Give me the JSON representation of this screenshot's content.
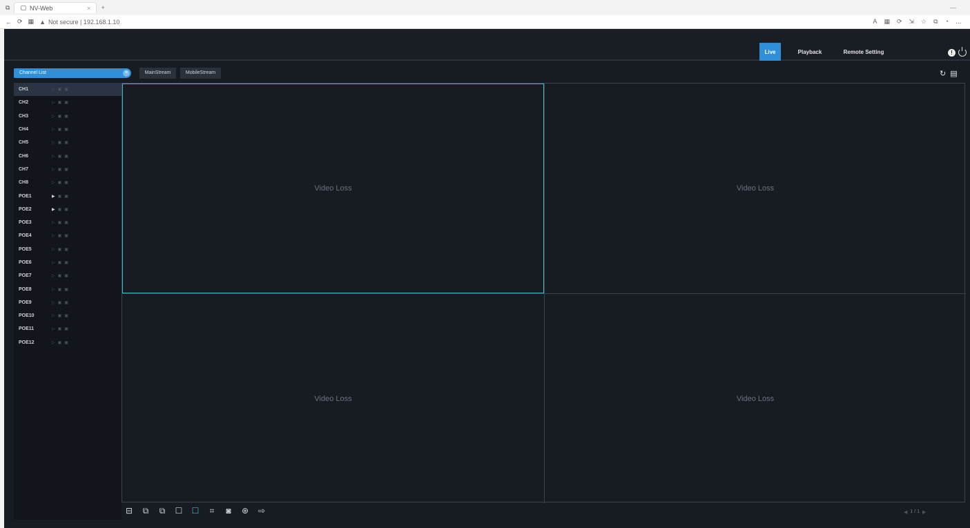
{
  "browser": {
    "tab_title": "NV-Web",
    "new_tab": "+",
    "address": "Not secure | 192.168.1.10",
    "right_icons": [
      "A",
      "☆",
      "⟳",
      "⇲",
      "☆",
      "⧉",
      "◔",
      "…"
    ]
  },
  "nav": {
    "live": "Live",
    "playback": "Playback",
    "remote_setting": "Remote Setting"
  },
  "channel_list": {
    "header": "Channel List",
    "items": [
      {
        "name": "CH1",
        "play_active": false,
        "selected": true
      },
      {
        "name": "CH2",
        "play_active": false,
        "selected": false
      },
      {
        "name": "CH3",
        "play_active": false,
        "selected": false
      },
      {
        "name": "CH4",
        "play_active": false,
        "selected": false
      },
      {
        "name": "CH5",
        "play_active": false,
        "selected": false
      },
      {
        "name": "CH6",
        "play_active": false,
        "selected": false
      },
      {
        "name": "CH7",
        "play_active": false,
        "selected": false
      },
      {
        "name": "CH8",
        "play_active": false,
        "selected": false
      },
      {
        "name": "POE1",
        "play_active": true,
        "selected": false
      },
      {
        "name": "POE2",
        "play_active": true,
        "selected": false
      },
      {
        "name": "POE3",
        "play_active": false,
        "selected": false
      },
      {
        "name": "POE4",
        "play_active": false,
        "selected": false
      },
      {
        "name": "POE5",
        "play_active": false,
        "selected": false
      },
      {
        "name": "POE6",
        "play_active": false,
        "selected": false
      },
      {
        "name": "POE7",
        "play_active": false,
        "selected": false
      },
      {
        "name": "POE8",
        "play_active": false,
        "selected": false
      },
      {
        "name": "POE9",
        "play_active": false,
        "selected": false
      },
      {
        "name": "POE10",
        "play_active": false,
        "selected": false
      },
      {
        "name": "POE11",
        "play_active": false,
        "selected": false
      },
      {
        "name": "POE12",
        "play_active": false,
        "selected": false
      }
    ]
  },
  "streams": {
    "main": "MainStream",
    "mobile": "MobileStream"
  },
  "video_cells": [
    "Video Loss",
    "Video Loss",
    "Video Loss",
    "Video Loss"
  ],
  "bottom_tools": [
    "⊟",
    "⧉",
    "⧉",
    "☐",
    "☐",
    "⌗",
    "◙",
    "⊕",
    "⇨"
  ],
  "pager": {
    "prev": "◀",
    "page": "1 / 1",
    "next": "▶"
  }
}
